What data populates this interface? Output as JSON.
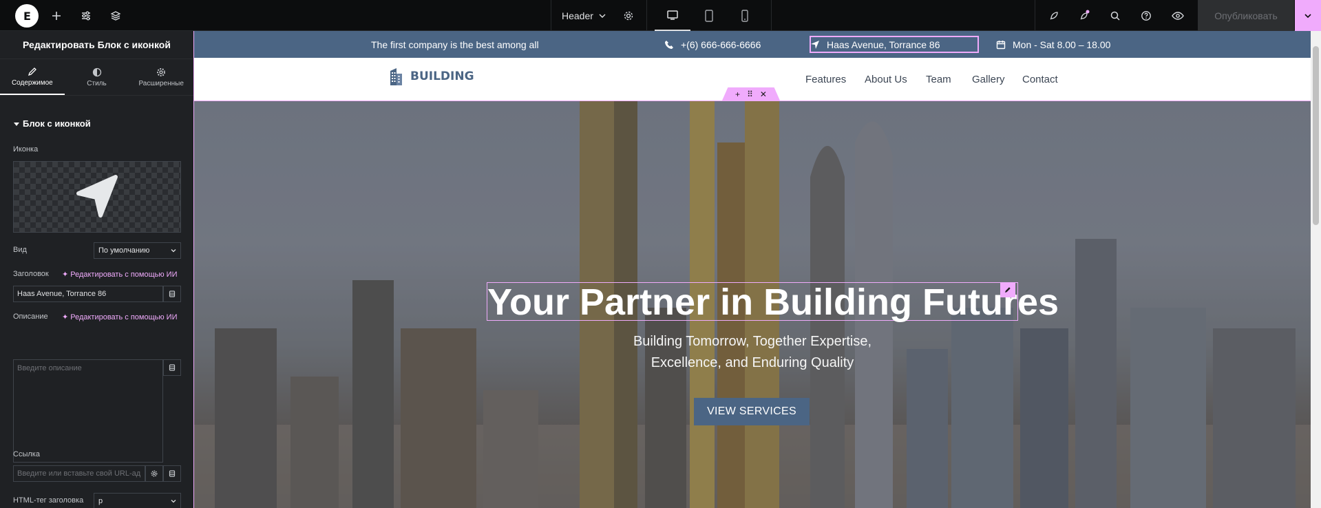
{
  "topbar": {
    "logo_icon": "elementor-logo-icon",
    "add_icon": "plus-icon",
    "settings_icon": "sliders-icon",
    "structure_icon": "layers-icon",
    "document_name": "Header",
    "devices": [
      "desktop",
      "tablet",
      "mobile"
    ],
    "publish_label": "Опубликовать"
  },
  "panel": {
    "title": "Редактировать Блок с иконкой",
    "tabs": [
      {
        "label": "Содержимое",
        "icon": "pencil-icon"
      },
      {
        "label": "Стиль",
        "icon": "half-circle-icon"
      },
      {
        "label": "Расширенные",
        "icon": "gear-icon"
      }
    ],
    "section_title": "Блок с иконкой",
    "icon_label": "Иконка",
    "view_label": "Вид",
    "view_value": "По умолчанию",
    "heading_label": "Заголовок",
    "ai_edit_label": "Редактировать с помощью ИИ",
    "heading_value": "Haas Avenue, Torrance 86",
    "description_label": "Описание",
    "description_placeholder": "Введите описание",
    "link_label": "Ссылка",
    "link_placeholder": "Введите или вставьте свой URL-ад",
    "html_tag_label": "HTML-тег заголовка",
    "html_tag_value": "p"
  },
  "site": {
    "topstrip": {
      "tagline": "The first company is the best among all",
      "phone": "+(6) 666-666-6666",
      "address": "Haas Avenue, Torrance 86",
      "hours": "Mon - Sat 8.00 – 18.00"
    },
    "brand": "BUILDING",
    "nav": [
      "Features",
      "About Us",
      "Team",
      "Gallery",
      "Contact"
    ],
    "hero": {
      "title": "Your Partner in Building Futures",
      "subtitle_line1": "Building Tomorrow, Together Expertise,",
      "subtitle_line2": "Excellence, and Enduring Quality",
      "button": "VIEW SERVICES"
    }
  },
  "colors": {
    "accent": "#f0abfc",
    "brand": "#4b6584",
    "panel_bg": "#1f2124"
  }
}
